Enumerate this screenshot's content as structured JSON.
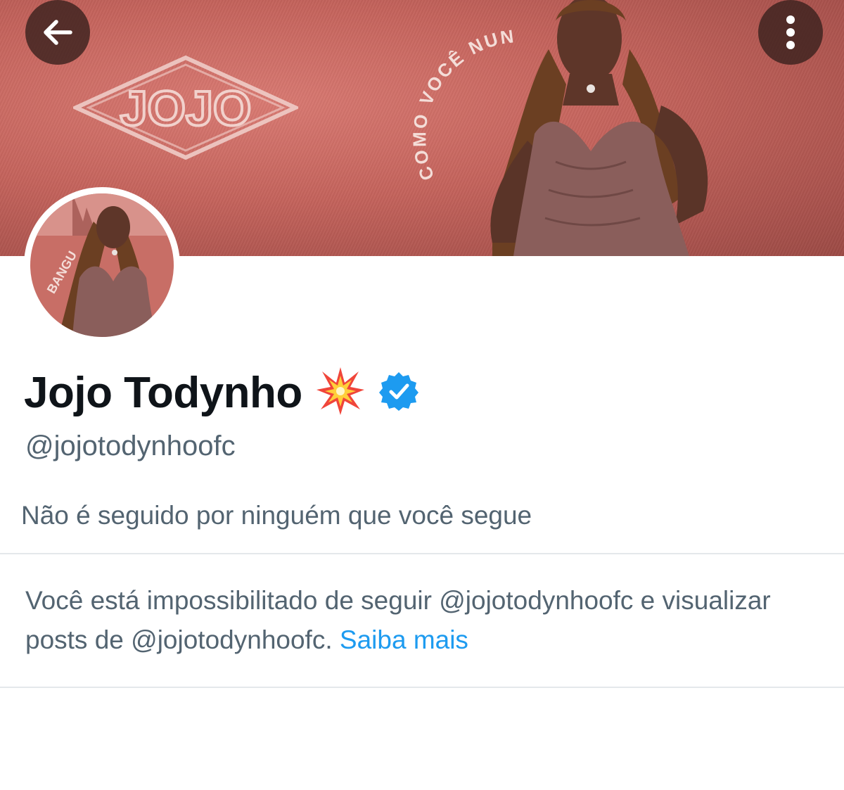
{
  "header": {
    "back_icon": "arrow-left-icon",
    "more_icon": "vertical-ellipsis-icon",
    "banner": {
      "logo_text": "JOJO",
      "arc_text": "COMO VOCÊ NUNCA VIU",
      "colors": {
        "banner": "#c4635c",
        "dress": "#8a5e5b"
      }
    }
  },
  "avatar": {
    "badge_text": "BANGU"
  },
  "profile": {
    "name": "Jojo Todynho",
    "name_emoji_icon": "collision-icon",
    "verified_icon": "verified-badge-icon",
    "handle": "@jojotodynhoofc",
    "follow_context": "Não é seguido por ninguém que você segue"
  },
  "blocked_notice": {
    "text": "Você está impossibilitado de seguir @jojotodynhoofc e visualizar posts de @jojotodynhoofc.",
    "link_label": "Saiba mais"
  },
  "colors": {
    "primary_text": "#0f1419",
    "secondary_text": "#536471",
    "link": "#1d9bf0",
    "verified": "#1d9bf0",
    "divider": "#e4e8eb"
  }
}
